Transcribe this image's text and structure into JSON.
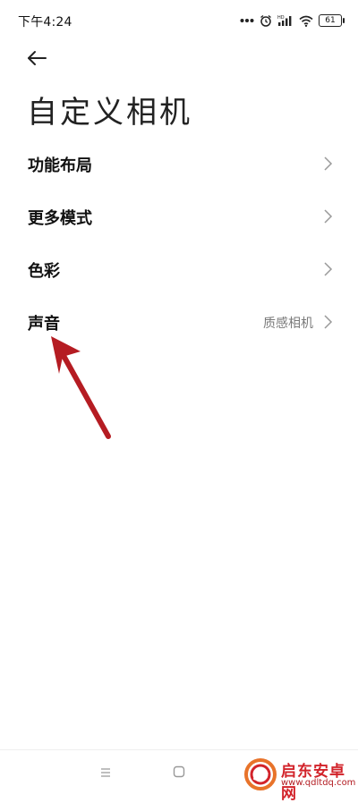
{
  "status_bar": {
    "time": "下午4:24",
    "battery": "61",
    "icons": [
      "more-dots-icon",
      "alarm-icon",
      "hd-signal-icon",
      "wifi-icon",
      "battery-icon"
    ]
  },
  "header": {
    "back_icon": "arrow-left-icon",
    "title": "自定义相机"
  },
  "menu": {
    "items": [
      {
        "label": "功能布局",
        "value": ""
      },
      {
        "label": "更多模式",
        "value": ""
      },
      {
        "label": "色彩",
        "value": ""
      },
      {
        "label": "声音",
        "value": "质感相机"
      }
    ]
  },
  "annotation": {
    "color": "#b51c22",
    "points_to": "声音"
  },
  "nav_bar": {
    "icons": [
      "menu-lines-icon",
      "home-square-icon"
    ]
  },
  "watermark": {
    "title": "启东安卓网",
    "url": "www.qdltdq.com",
    "color": "#d2232a"
  }
}
